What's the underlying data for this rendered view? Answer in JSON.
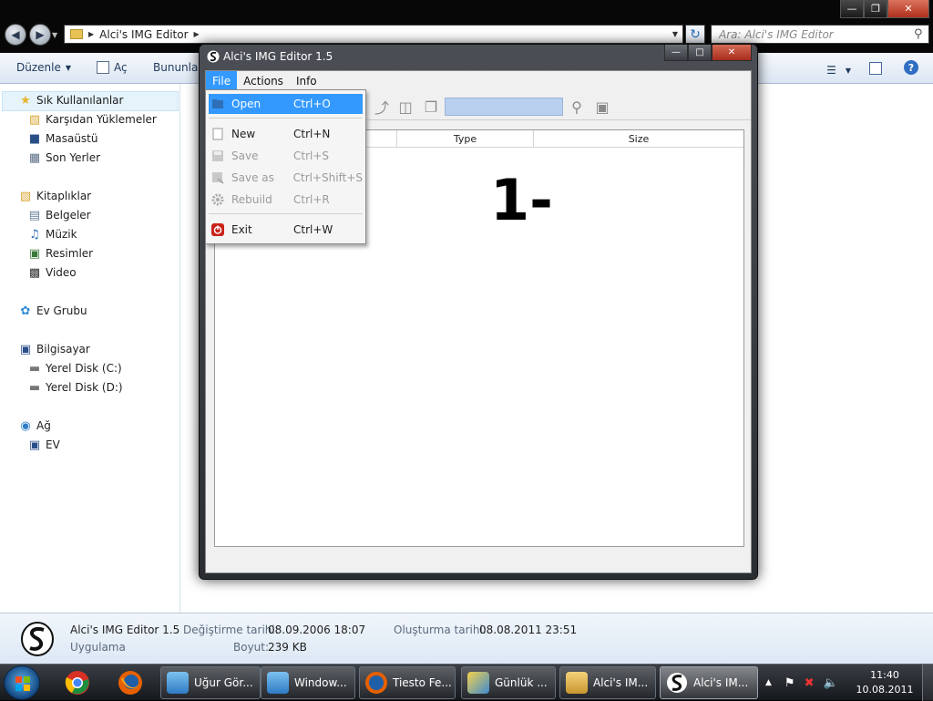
{
  "explorer": {
    "address": {
      "crumb": "Alci's IMG Editor"
    },
    "search": {
      "placeholder": "Ara: Alci's IMG Editor"
    },
    "cmdbar": {
      "organize": "Düzenle",
      "open": "Aç",
      "share": "Bununla"
    },
    "sidebar": {
      "favorites": "Sık Kullanılanlar",
      "downloads": "Karşıdan Yüklemeler",
      "desktop": "Masaüstü",
      "recent": "Son Yerler",
      "libraries": "Kitaplıklar",
      "documents": "Belgeler",
      "music": "Müzik",
      "pictures": "Resimler",
      "video": "Video",
      "homegroup": "Ev Grubu",
      "computer": "Bilgisayar",
      "disk_c": "Yerel Disk (C:)",
      "disk_d": "Yerel Disk (D:)",
      "network": "Ağ",
      "ev": "EV"
    },
    "details": {
      "name": "Alci's IMG Editor 1.5",
      "kind": "Uygulama",
      "modified_label": "Değiştirme tarihi:",
      "modified_value": "08.09.2006 18:07",
      "size_label": "Boyut:",
      "size_value": "239 KB",
      "created_label": "Oluşturma tarihi:",
      "created_value": "08.08.2011 23:51"
    }
  },
  "app": {
    "title": "Alci's IMG Editor 1.5",
    "menus": [
      "File",
      "Actions",
      "Info"
    ],
    "columns": {
      "type": "Type",
      "size": "Size"
    },
    "annotation": "1-",
    "file_menu": {
      "open": {
        "label": "Open",
        "shortcut": "Ctrl+O"
      },
      "new": {
        "label": "New",
        "shortcut": "Ctrl+N"
      },
      "save": {
        "label": "Save",
        "shortcut": "Ctrl+S"
      },
      "save_as": {
        "label": "Save as",
        "shortcut": "Ctrl+Shift+S"
      },
      "rebuild": {
        "label": "Rebuild",
        "shortcut": "Ctrl+R"
      },
      "exit": {
        "label": "Exit",
        "shortcut": "Ctrl+W"
      }
    }
  },
  "taskbar": {
    "tasks": [
      "Uğur Gör...",
      "Window...",
      "Tiesto Fe...",
      "Günlük ...",
      "Alci's IM...",
      "Alci's IM..."
    ],
    "clock": {
      "time": "11:40",
      "date": "10.08.2011"
    }
  },
  "colors": {
    "menu_highlight": "#3399ff",
    "titlebar": "#070707",
    "cmdbar": "#dce6f3"
  }
}
